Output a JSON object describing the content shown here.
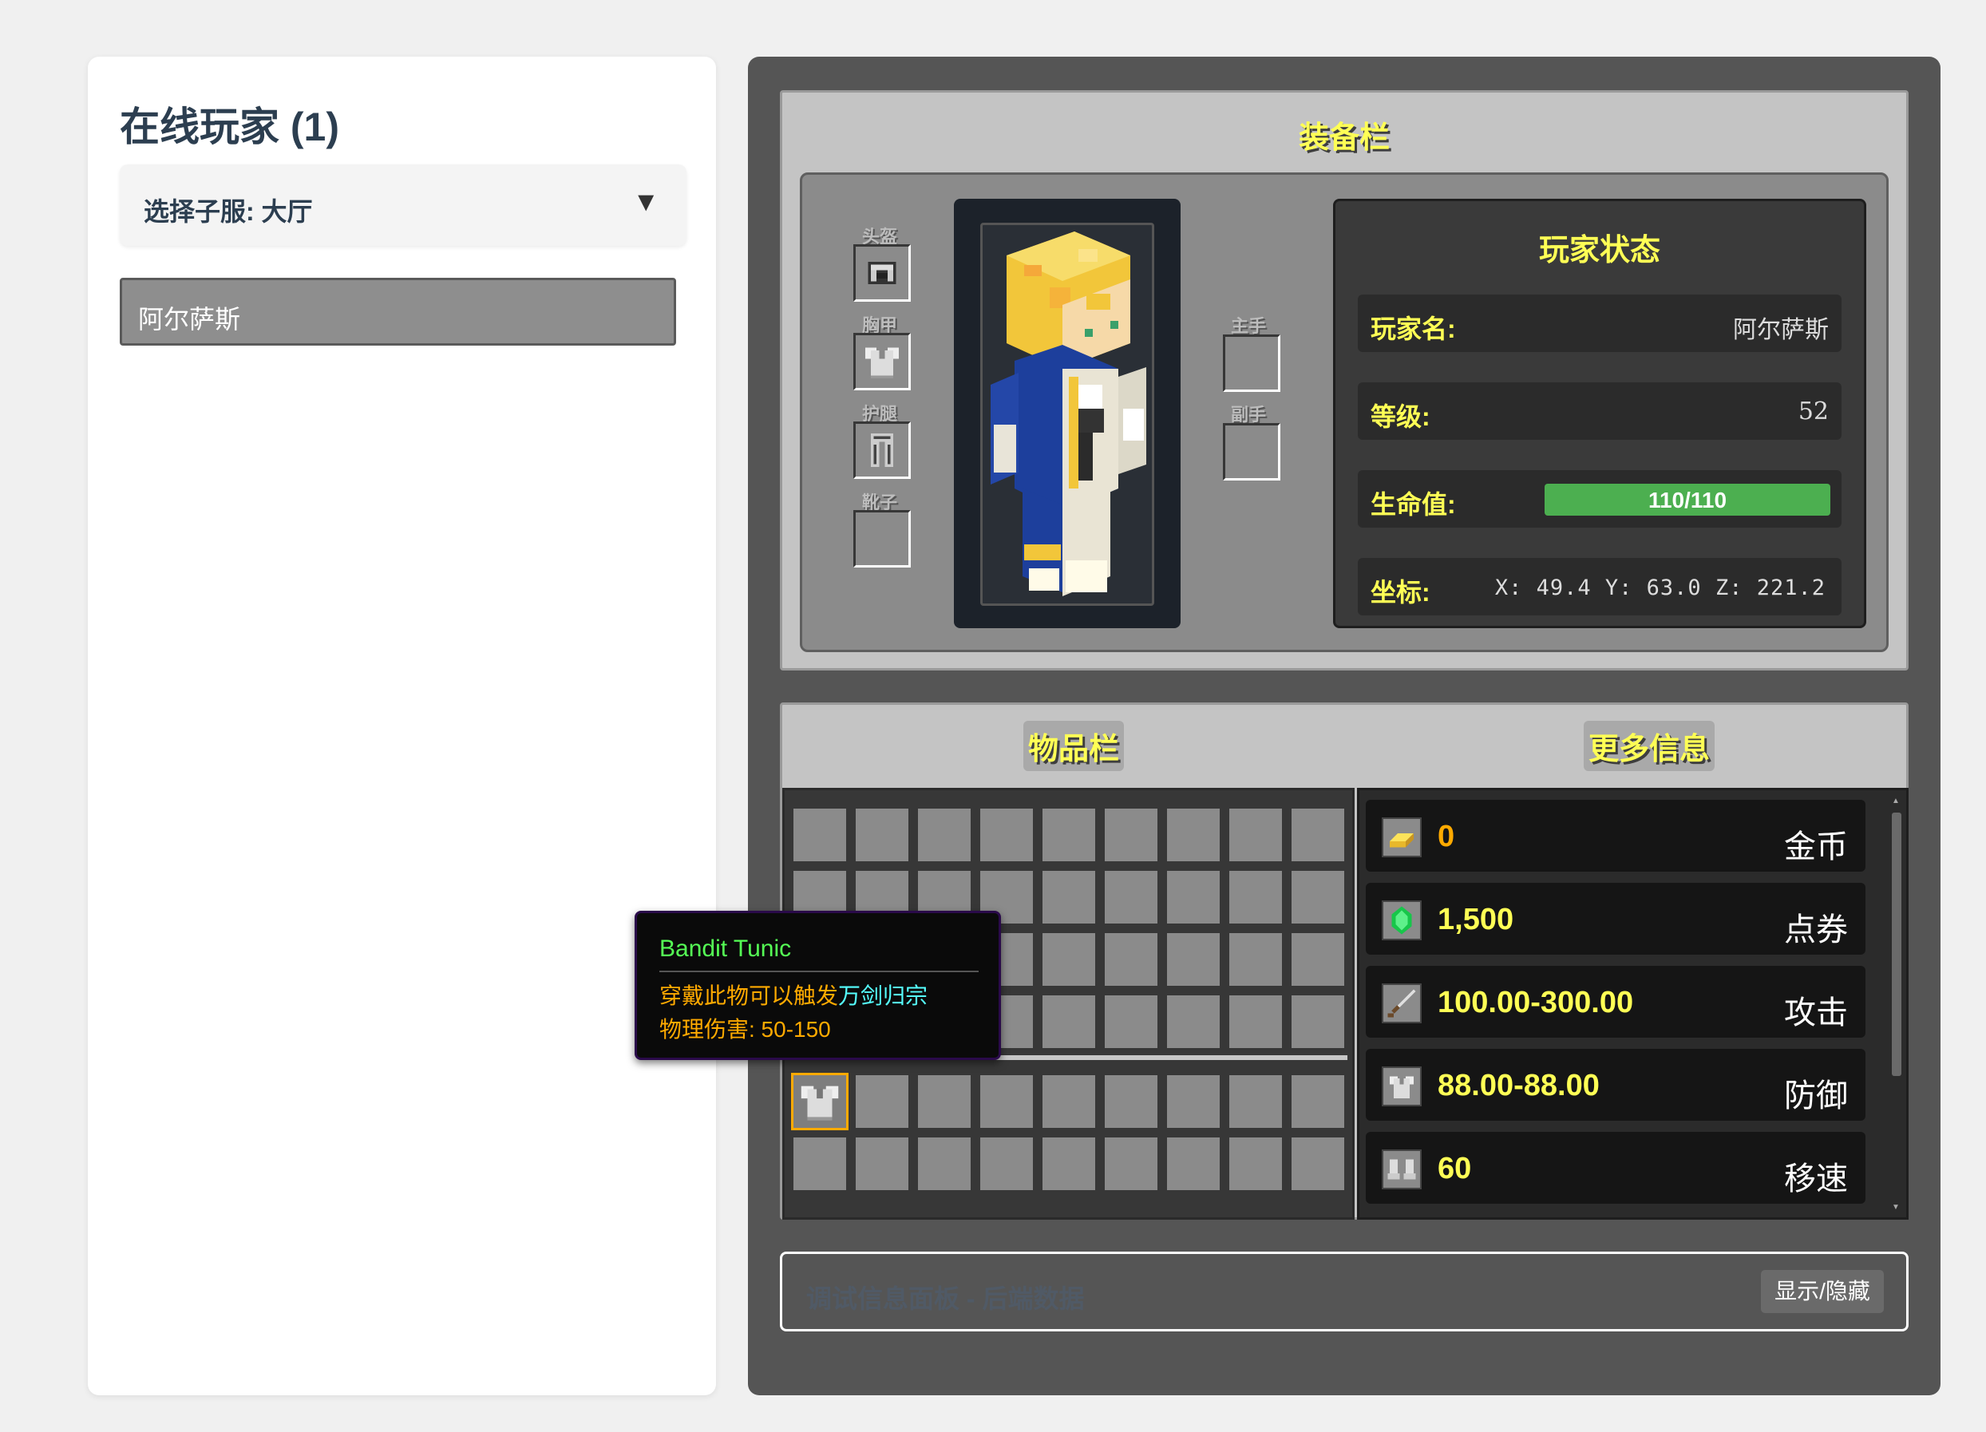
{
  "left": {
    "title": "在线玩家 (1)",
    "server_select": "选择子服: 大厅",
    "select_arrow": "▼",
    "players": [
      "阿尔萨斯"
    ]
  },
  "equipment": {
    "title": "装备栏",
    "slots": {
      "helmet": "头盔",
      "chest": "胸甲",
      "legs": "护腿",
      "boots": "靴子",
      "mainhand": "主手",
      "offhand": "副手"
    }
  },
  "status": {
    "title": "玩家状态",
    "name_label": "玩家名:",
    "name_value": "阿尔萨斯",
    "level_label": "等级:",
    "level_value": "52",
    "hp_label": "生命值:",
    "hp_text": "110/110",
    "hp_fraction": 1.0,
    "coord_label": "坐标:",
    "coord_value": "X: 49.4  Y: 63.0  Z: 221.2"
  },
  "inventory": {
    "title": "物品栏",
    "more_title": "更多信息"
  },
  "info": [
    {
      "icon": "gold-ingot-icon",
      "value": "0",
      "name": "金币",
      "value_color": "#ffaa00"
    },
    {
      "icon": "emerald-icon",
      "value": "1,500",
      "name": "点券",
      "value_color": "#ffff55"
    },
    {
      "icon": "sword-icon",
      "value": "100.00-300.00",
      "name": "攻击",
      "value_color": "#ffff55"
    },
    {
      "icon": "chestplate-icon",
      "value": "88.00-88.00",
      "name": "防御",
      "value_color": "#ffff55"
    },
    {
      "icon": "boots-icon",
      "value": "60",
      "name": "移速",
      "value_color": "#ffff55"
    }
  ],
  "debug": {
    "label": "调试信息面板 - 后端数据",
    "toggle": "显示/隐藏"
  },
  "tooltip": {
    "name": "Bandit Tunic",
    "line1_prefix": "穿戴此物可以触发",
    "line1_highlight": "万剑归宗",
    "line2": "物理伤害: 50-150"
  }
}
